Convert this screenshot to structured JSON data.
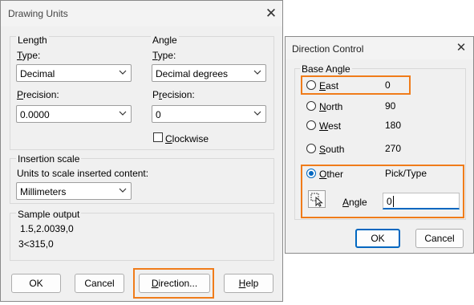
{
  "drawing_units": {
    "title": "Drawing Units",
    "length": {
      "group_label": "Length",
      "type_label": "Type:",
      "type_value": "Decimal",
      "precision_label": "Precision:",
      "precision_value": "0.0000"
    },
    "angle": {
      "group_label": "Angle",
      "type_label": "Type:",
      "type_value": "Decimal degrees",
      "precision_label": "Precision:",
      "precision_value": "0",
      "clockwise_label": "Clockwise",
      "clockwise_checked": false
    },
    "insertion_scale": {
      "group_label": "Insertion scale",
      "units_label": "Units to scale inserted content:",
      "units_value": "Millimeters"
    },
    "sample_output": {
      "group_label": "Sample output",
      "line1": "1.5,2.0039,0",
      "line2": "3<315,0"
    },
    "buttons": {
      "ok": "OK",
      "cancel": "Cancel",
      "direction": "Direction...",
      "help": "Help"
    }
  },
  "direction_control": {
    "title": "Direction Control",
    "base_angle_label": "Base Angle",
    "options": {
      "east": {
        "label": "East",
        "value": "0"
      },
      "north": {
        "label": "North",
        "value": "90"
      },
      "west": {
        "label": "West",
        "value": "180"
      },
      "south": {
        "label": "South",
        "value": "270"
      },
      "other": {
        "label": "Other",
        "value": "Pick/Type"
      }
    },
    "selected": "Other",
    "angle_label": "Angle",
    "angle_value": "0",
    "buttons": {
      "ok": "OK",
      "cancel": "Cancel"
    }
  },
  "colors": {
    "highlight": "#f07c1a",
    "accent": "#0067c0"
  }
}
